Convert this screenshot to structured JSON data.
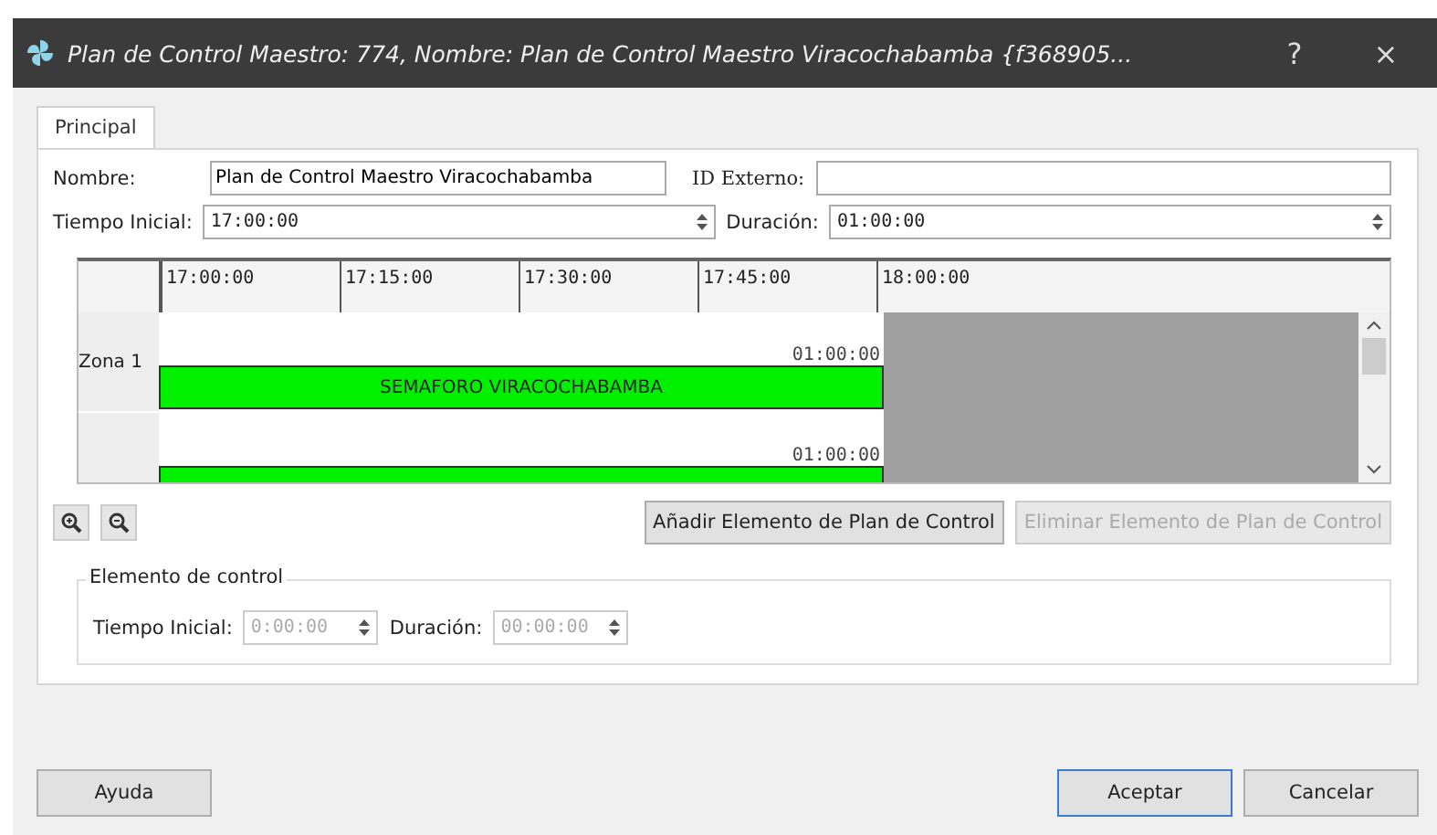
{
  "window": {
    "title": "Plan de Control Maestro: 774, Nombre: Plan de Control Maestro Viracochabamba  {f368905...",
    "help": "?",
    "close": "×"
  },
  "tabs": [
    {
      "label": "Principal",
      "selected": true
    }
  ],
  "form": {
    "nombre_label": "Nombre:",
    "nombre": "Plan de Control Maestro Viracochabamba",
    "id_label": "ID Externo:",
    "tiempo_label": "Tiempo Inicial:",
    "tiempo": "17:00:00",
    "duracion_label": "Duración:",
    "duracion": "01:00:00"
  },
  "timeline": {
    "ticks": [
      "17:00:00",
      "17:15:00",
      "17:30:00",
      "17:45:00",
      "18:00:00"
    ],
    "rows": [
      {
        "label": "Zona 1",
        "duration": "01:00:00",
        "bar": "SEMAFORO VIRACOCHABAMBA"
      },
      {
        "duration": "01:00:00"
      }
    ]
  },
  "actions": [
    {
      "label": "Añadir Elemento de Plan de Control",
      "disabled": false
    },
    {
      "label": "Eliminar Elemento de Plan de Control",
      "disabled": true
    }
  ],
  "element_group": {
    "title": "Elemento de control",
    "tiempo_label": "Tiempo Inicial:",
    "tiempo": "0:00:00",
    "duracion_label": "Duración:",
    "duracion": "00:00:00",
    "disabled": true
  },
  "footer": [
    {
      "label": "Ayuda",
      "default": false
    },
    {
      "label": "Aceptar",
      "default": true
    },
    {
      "label": "Cancelar",
      "default": false
    }
  ]
}
